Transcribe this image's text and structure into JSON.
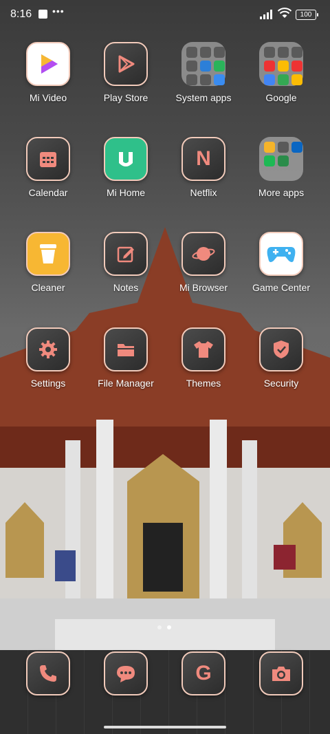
{
  "status": {
    "time": "8:16",
    "battery": "100"
  },
  "rows": [
    [
      {
        "label": "Mi Video",
        "icon": "mi-video-icon"
      },
      {
        "label": "Play Store",
        "icon": "play-store-icon"
      },
      {
        "label": "System apps",
        "icon": "folder-icon"
      },
      {
        "label": "Google",
        "icon": "folder-icon"
      }
    ],
    [
      {
        "label": "Calendar",
        "icon": "calendar-icon"
      },
      {
        "label": "Mi Home",
        "icon": "mi-home-icon"
      },
      {
        "label": "Netflix",
        "icon": "netflix-icon"
      },
      {
        "label": "More apps",
        "icon": "folder-icon"
      }
    ],
    [
      {
        "label": "Cleaner",
        "icon": "cleaner-icon"
      },
      {
        "label": "Notes",
        "icon": "notes-icon"
      },
      {
        "label": "Mi Browser",
        "icon": "browser-icon"
      },
      {
        "label": "Game Center",
        "icon": "gamepad-icon"
      }
    ],
    [
      {
        "label": "Settings",
        "icon": "gear-icon"
      },
      {
        "label": "File Manager",
        "icon": "file-manager-icon"
      },
      {
        "label": "Themes",
        "icon": "tshirt-icon"
      },
      {
        "label": "Security",
        "icon": "shield-icon"
      }
    ]
  ],
  "dock": [
    {
      "icon": "phone-icon"
    },
    {
      "icon": "messages-icon"
    },
    {
      "icon": "google-icon",
      "glyph": "G"
    },
    {
      "icon": "camera-icon"
    }
  ],
  "netflix_glyph": "N",
  "colors": {
    "accent": "#f08a7e",
    "icon_border": "#f2cbbb"
  }
}
